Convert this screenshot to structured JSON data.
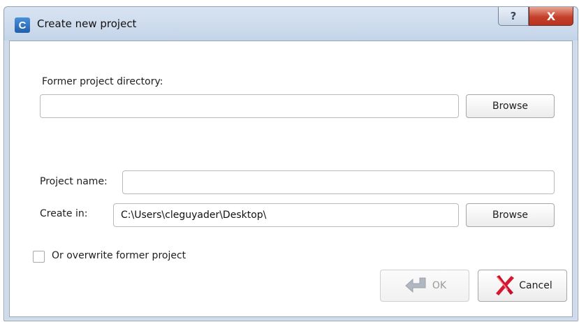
{
  "window": {
    "app_icon_letter": "C",
    "title": "Create new project",
    "help_glyph": "?",
    "close_glyph": "X"
  },
  "form": {
    "former_dir_label": "Former project directory:",
    "former_dir_value": "",
    "browse_label_1": "Browse",
    "project_name_label": "Project name:",
    "project_name_value": "",
    "create_in_label": "Create in:",
    "create_in_value": "C:\\Users\\cleguyader\\Desktop\\",
    "browse_label_2": "Browse",
    "overwrite_label": "Or overwrite former project",
    "overwrite_checked": false
  },
  "actions": {
    "ok_label": "OK",
    "ok_enabled": false,
    "cancel_label": "Cancel"
  },
  "icons": {
    "app": "app-c-icon",
    "help": "help-icon",
    "close": "close-icon",
    "ok": "arrow-enter-icon",
    "cancel": "red-x-icon"
  },
  "colors": {
    "title_gradient_top": "#d9e4f2",
    "close_red": "#c5402c",
    "cancel_red": "#c8102e",
    "ok_disabled_gray": "#b0b7c0"
  }
}
